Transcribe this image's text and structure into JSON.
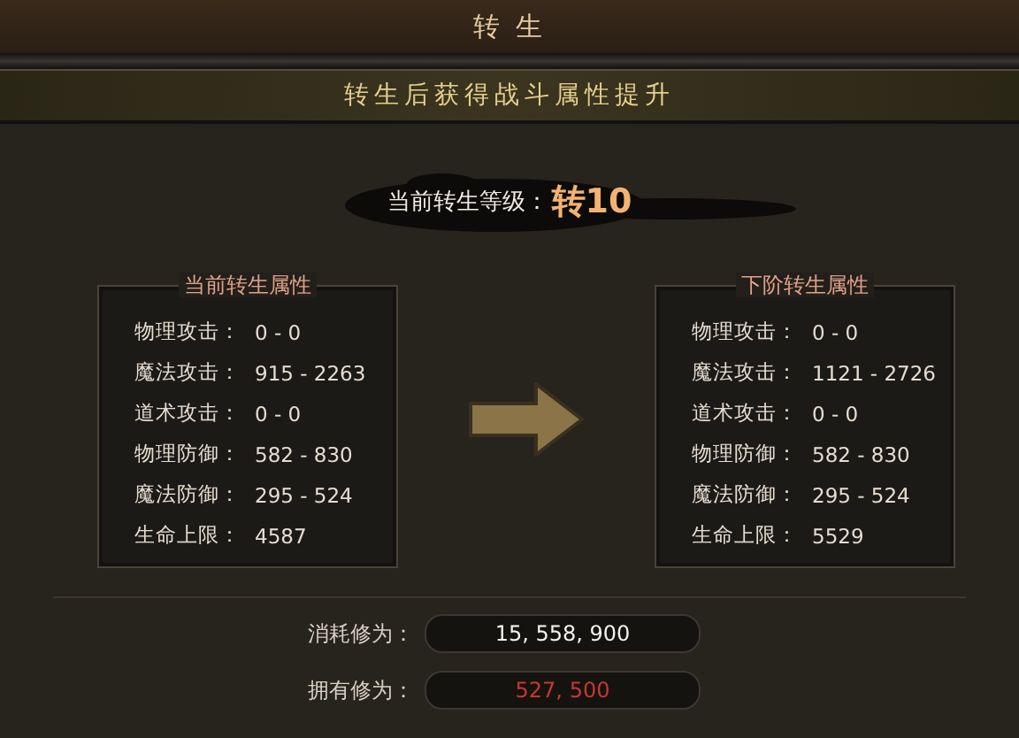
{
  "window": {
    "title": "转 生"
  },
  "banner": "转生后获得战斗属性提升",
  "current_level": {
    "label": "当前转生等级：",
    "value": "转10"
  },
  "panels": [
    {
      "title": "当前转生属性",
      "stats": [
        {
          "label": "物理攻击：",
          "value": "0 - 0"
        },
        {
          "label": "魔法攻击：",
          "value": "915 - 2263"
        },
        {
          "label": "道术攻击：",
          "value": "0 - 0"
        },
        {
          "label": "物理防御：",
          "value": "582 - 830"
        },
        {
          "label": "魔法防御：",
          "value": "295 - 524"
        },
        {
          "label": "生命上限：",
          "value": "4587"
        }
      ]
    },
    {
      "title": "下阶转生属性",
      "stats": [
        {
          "label": "物理攻击：",
          "value": "0 - 0"
        },
        {
          "label": "魔法攻击：",
          "value": "1121 - 2726"
        },
        {
          "label": "道术攻击：",
          "value": "0 - 0"
        },
        {
          "label": "物理防御：",
          "value": "582 - 830"
        },
        {
          "label": "魔法防御：",
          "value": "295 - 524"
        },
        {
          "label": "生命上限：",
          "value": "5529"
        }
      ]
    }
  ],
  "costs": [
    {
      "label": "消耗修为：",
      "value": "15, 558, 900",
      "insufficient": false
    },
    {
      "label": "拥有修为：",
      "value": "527, 500",
      "insufficient": true
    }
  ]
}
